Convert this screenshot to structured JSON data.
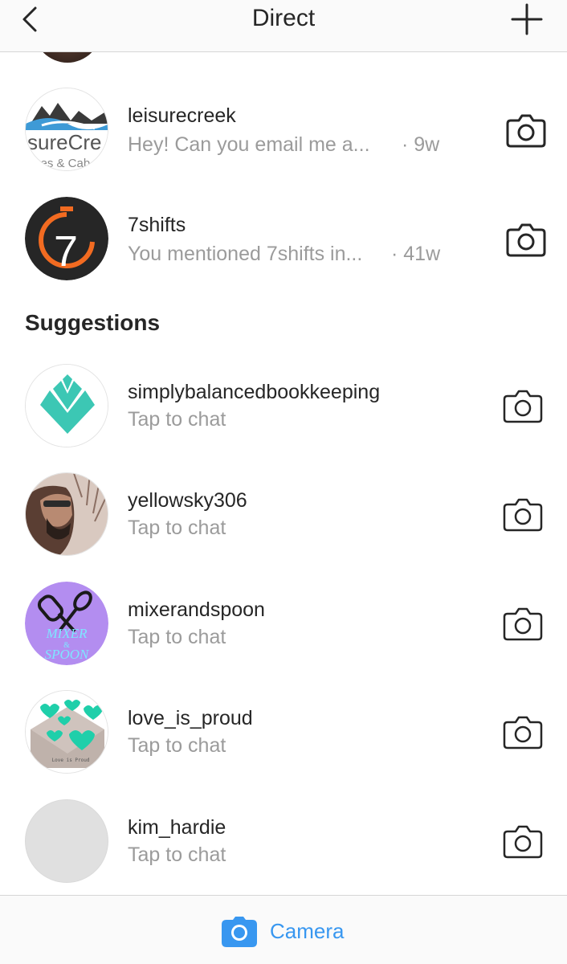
{
  "header": {
    "title": "Direct",
    "back_icon": "chevron-left-icon",
    "new_icon": "plus-icon"
  },
  "threads": [
    {
      "username": "leisurecreek",
      "preview": "Hey! Can you email me a...",
      "time": "· 9w",
      "avatar_text_main": "sureCre",
      "avatar_text_sub": "mes & Cab"
    },
    {
      "username": "7shifts",
      "preview": "You mentioned 7shifts in...",
      "time": "· 41w",
      "avatar_text_main": "7"
    }
  ],
  "suggestions_title": "Suggestions",
  "suggestions": [
    {
      "username": "simplybalancedbookkeeping",
      "sub": "Tap to chat"
    },
    {
      "username": "yellowsky306",
      "sub": "Tap to chat"
    },
    {
      "username": "mixerandspoon",
      "sub": "Tap to chat",
      "avatar_text_1": "MIXER",
      "avatar_text_2": "&",
      "avatar_text_3": "SPOON"
    },
    {
      "username": "love_is_proud",
      "sub": "Tap to chat",
      "avatar_text": "Love is Proud"
    },
    {
      "username": "kim_hardie",
      "sub": "Tap to chat"
    }
  ],
  "bottom_bar": {
    "camera_label": "Camera",
    "camera_icon": "camera-icon"
  },
  "colors": {
    "accent": "#3897f0",
    "secondary_text": "#9b9b9b",
    "teal": "#3cc7b4",
    "orange": "#f26b21"
  }
}
